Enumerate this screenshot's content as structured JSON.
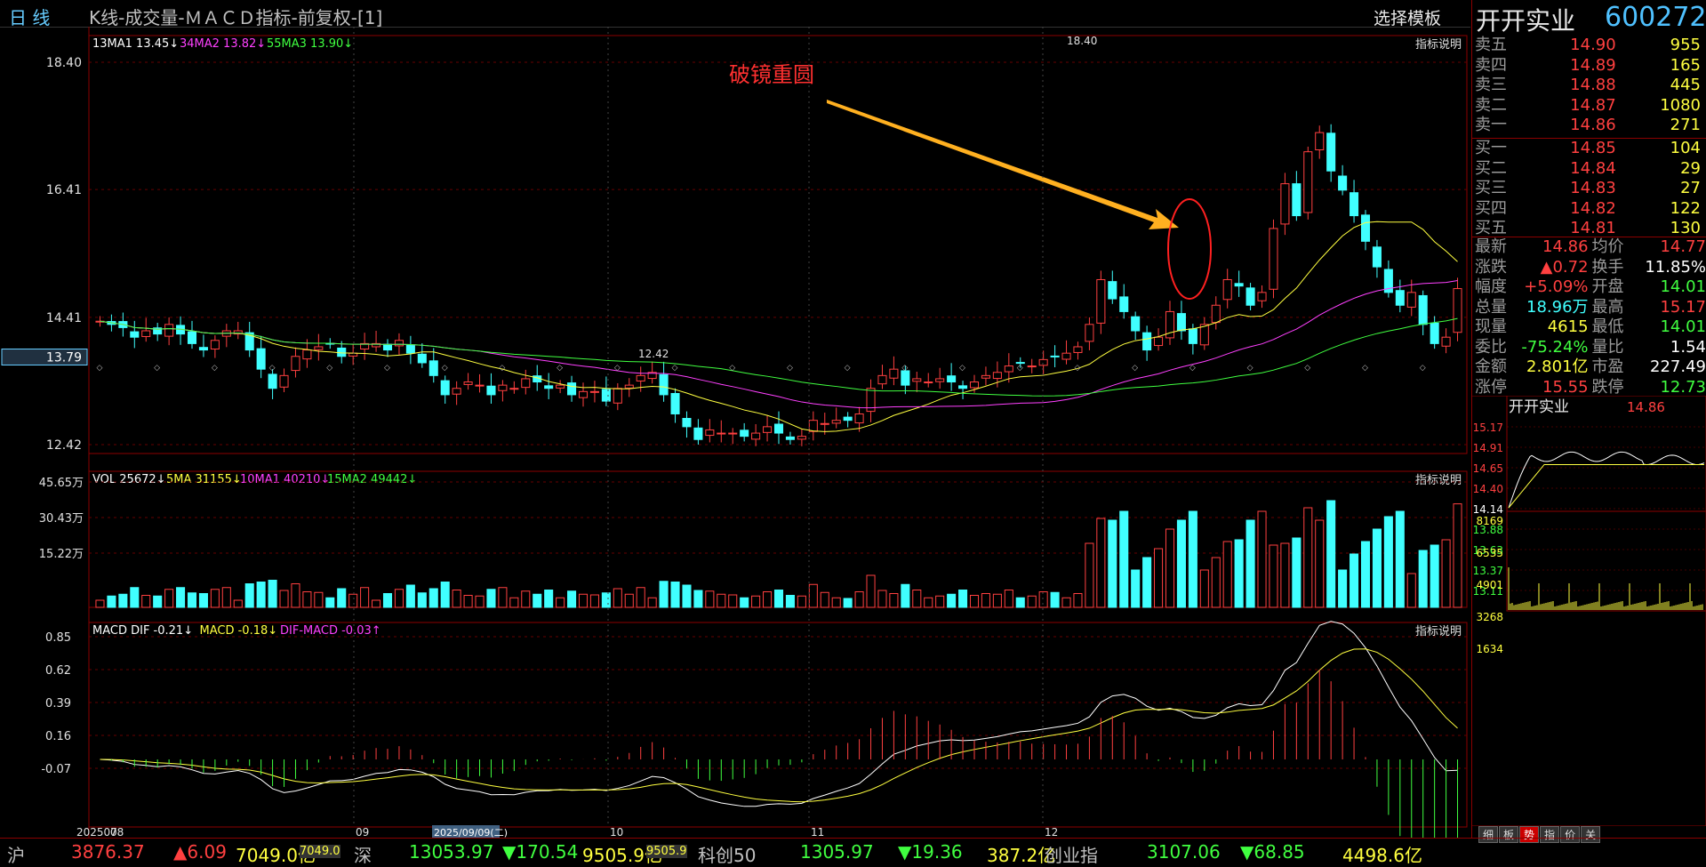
{
  "toolbar": {
    "period": "日 线",
    "title": "K线-成交量-ＭＡＣＤ指标-前复权-[1]",
    "template": "选择模板"
  },
  "kline": {
    "legend": [
      {
        "text": "13MA1 13.45↓",
        "color": "#ffffff"
      },
      {
        "text": "34MA2 13.82↓",
        "color": "#ff40ff"
      },
      {
        "text": "55MA3 13.90↓",
        "color": "#40ff40"
      }
    ],
    "help": "指标说明",
    "yticks": [
      "18.40",
      "16.41",
      "14.41",
      "12.42"
    ],
    "cursor_price": "13.79",
    "high_mark": "18.40",
    "low_mark": "12.42",
    "annotation": "破镜重圆"
  },
  "volume": {
    "legend": [
      {
        "text": "VOL 25672↓",
        "color": "#ffffff"
      },
      {
        "text": "5MA 31155↓",
        "color": "#ffff40"
      },
      {
        "text": "10MA1 40210↓",
        "color": "#ff40ff"
      },
      {
        "text": "15MA2 49442↓",
        "color": "#40ff40"
      }
    ],
    "help": "指标说明",
    "yticks": [
      "45.65万",
      "30.43万",
      "15.22万"
    ]
  },
  "macd": {
    "legend": [
      {
        "text": "MACD DIF -0.21↓",
        "color": "#ffffff"
      },
      {
        "text": "MACD -0.18↓",
        "color": "#ffff40"
      },
      {
        "text": "DIF-MACD -0.03↑",
        "color": "#ff40ff"
      }
    ],
    "help": "指标说明",
    "yticks": [
      "0.85",
      "0.62",
      "0.39",
      "0.16",
      "-0.07"
    ]
  },
  "xaxis": {
    "labels": [
      "202507",
      "08",
      "09",
      "10",
      "11",
      "12"
    ],
    "cursor_date": "2025/09/09(二)"
  },
  "chart_data": {
    "type": "candlestick",
    "ylim": [
      12.42,
      18.4
    ],
    "closes": [
      14.35,
      14.3,
      14.25,
      14.1,
      14.2,
      14.15,
      14.3,
      14.15,
      14.0,
      13.9,
      14.05,
      14.2,
      14.2,
      13.9,
      13.6,
      13.3,
      13.5,
      13.8,
      13.9,
      13.95,
      14.0,
      13.8,
      13.85,
      14.0,
      14.0,
      13.9,
      14.05,
      13.85,
      13.7,
      13.5,
      13.2,
      13.3,
      13.4,
      13.35,
      13.2,
      13.35,
      13.3,
      13.45,
      13.4,
      13.3,
      13.35,
      13.2,
      13.25,
      13.25,
      13.1,
      13.3,
      13.35,
      13.5,
      13.55,
      13.2,
      12.9,
      12.7,
      12.5,
      12.65,
      12.6,
      12.6,
      12.55,
      12.6,
      12.7,
      12.6,
      12.5,
      12.55,
      12.8,
      12.75,
      12.8,
      12.8,
      12.9,
      13.3,
      13.5,
      13.6,
      13.35,
      13.45,
      13.4,
      13.45,
      13.4,
      13.3,
      13.4,
      13.5,
      13.55,
      13.65,
      13.7,
      13.65,
      13.75,
      13.8,
      13.85,
      13.95,
      14.3,
      15.0,
      14.7,
      14.5,
      14.2,
      13.9,
      14.1,
      14.5,
      14.2,
      14.0,
      14.3,
      14.6,
      15.0,
      14.9,
      14.6,
      14.8,
      15.8,
      16.5,
      16.0,
      17.0,
      17.3,
      16.7,
      16.4,
      16.0,
      15.6,
      15.2,
      14.8,
      14.6,
      14.8,
      14.3,
      14.0,
      14.1,
      14.86
    ],
    "series": [
      {
        "name": "VOL"
      },
      {
        "name": "MACD DIF"
      }
    ]
  },
  "quote": {
    "name": "开开实业",
    "code": "600272",
    "asks": [
      {
        "label": "卖五",
        "price": "14.90",
        "vol": "955"
      },
      {
        "label": "卖四",
        "price": "14.89",
        "vol": "165"
      },
      {
        "label": "卖三",
        "price": "14.88",
        "vol": "445"
      },
      {
        "label": "卖二",
        "price": "14.87",
        "vol": "1080"
      },
      {
        "label": "卖一",
        "price": "14.86",
        "vol": "271"
      }
    ],
    "bids": [
      {
        "label": "买一",
        "price": "14.85",
        "vol": "104"
      },
      {
        "label": "买二",
        "price": "14.84",
        "vol": "29"
      },
      {
        "label": "买三",
        "price": "14.83",
        "vol": "27"
      },
      {
        "label": "买四",
        "price": "14.82",
        "vol": "122"
      },
      {
        "label": "买五",
        "price": "14.81",
        "vol": "130"
      }
    ],
    "stats": [
      {
        "l1": "最新",
        "v1": "14.86",
        "c1": "#ff4040",
        "l2": "均价",
        "v2": "14.77",
        "c2": "#ff4040"
      },
      {
        "l1": "涨跌",
        "v1": "▲0.72",
        "c1": "#ff4040",
        "l2": "换手",
        "v2": "11.85%",
        "c2": "#ffffff"
      },
      {
        "l1": "幅度",
        "v1": "+5.09%",
        "c1": "#ff4040",
        "l2": "开盘",
        "v2": "14.01",
        "c2": "#40ff40"
      },
      {
        "l1": "总量",
        "v1": "18.96万",
        "c1": "#40ffff",
        "l2": "最高",
        "v2": "15.17",
        "c2": "#ff4040"
      },
      {
        "l1": "现量",
        "v1": "4615",
        "c1": "#ffff40",
        "l2": "最低",
        "v2": "14.01",
        "c2": "#40ff40"
      },
      {
        "l1": "委比",
        "v1": "-75.24%",
        "c1": "#40ff40",
        "l2": "量比",
        "v2": "1.54",
        "c2": "#ffffff"
      },
      {
        "l1": "金额",
        "v1": "2.801亿",
        "c1": "#ffff40",
        "l2": "市盈",
        "v2": "227.49",
        "c2": "#ffffff"
      },
      {
        "l1": "涨停",
        "v1": "15.55",
        "c1": "#ff4040",
        "l2": "跌停",
        "v2": "12.73",
        "c2": "#40ff40"
      }
    ],
    "intraday_title": "开开实业",
    "intraday_price": "14.86",
    "intraday_yticks": [
      "15.17",
      "14.91",
      "14.65",
      "14.40",
      "14.14",
      "13.88",
      "13.63",
      "13.37",
      "13.11"
    ],
    "intraday_vol_ticks": [
      "8169",
      "6535",
      "4901",
      "3268",
      "1634"
    ],
    "tabs": [
      "细",
      "板",
      "势",
      "指",
      "价",
      "关"
    ]
  },
  "indices": [
    {
      "name": "沪",
      "value": "3876.37",
      "change": "▲6.09",
      "amount": "7049.0亿",
      "amount2": "7049.0"
    },
    {
      "name": "深",
      "value": "13053.97",
      "change": "▼170.54",
      "amount": "9505.9亿",
      "amount2": "9505.9"
    },
    {
      "name": "科创50",
      "value": "1305.97",
      "change": "▼19.36",
      "amount": "387.2亿"
    },
    {
      "name": "创业指",
      "value": "3107.06",
      "change": "▼68.85",
      "amount": "4498.6亿"
    }
  ]
}
